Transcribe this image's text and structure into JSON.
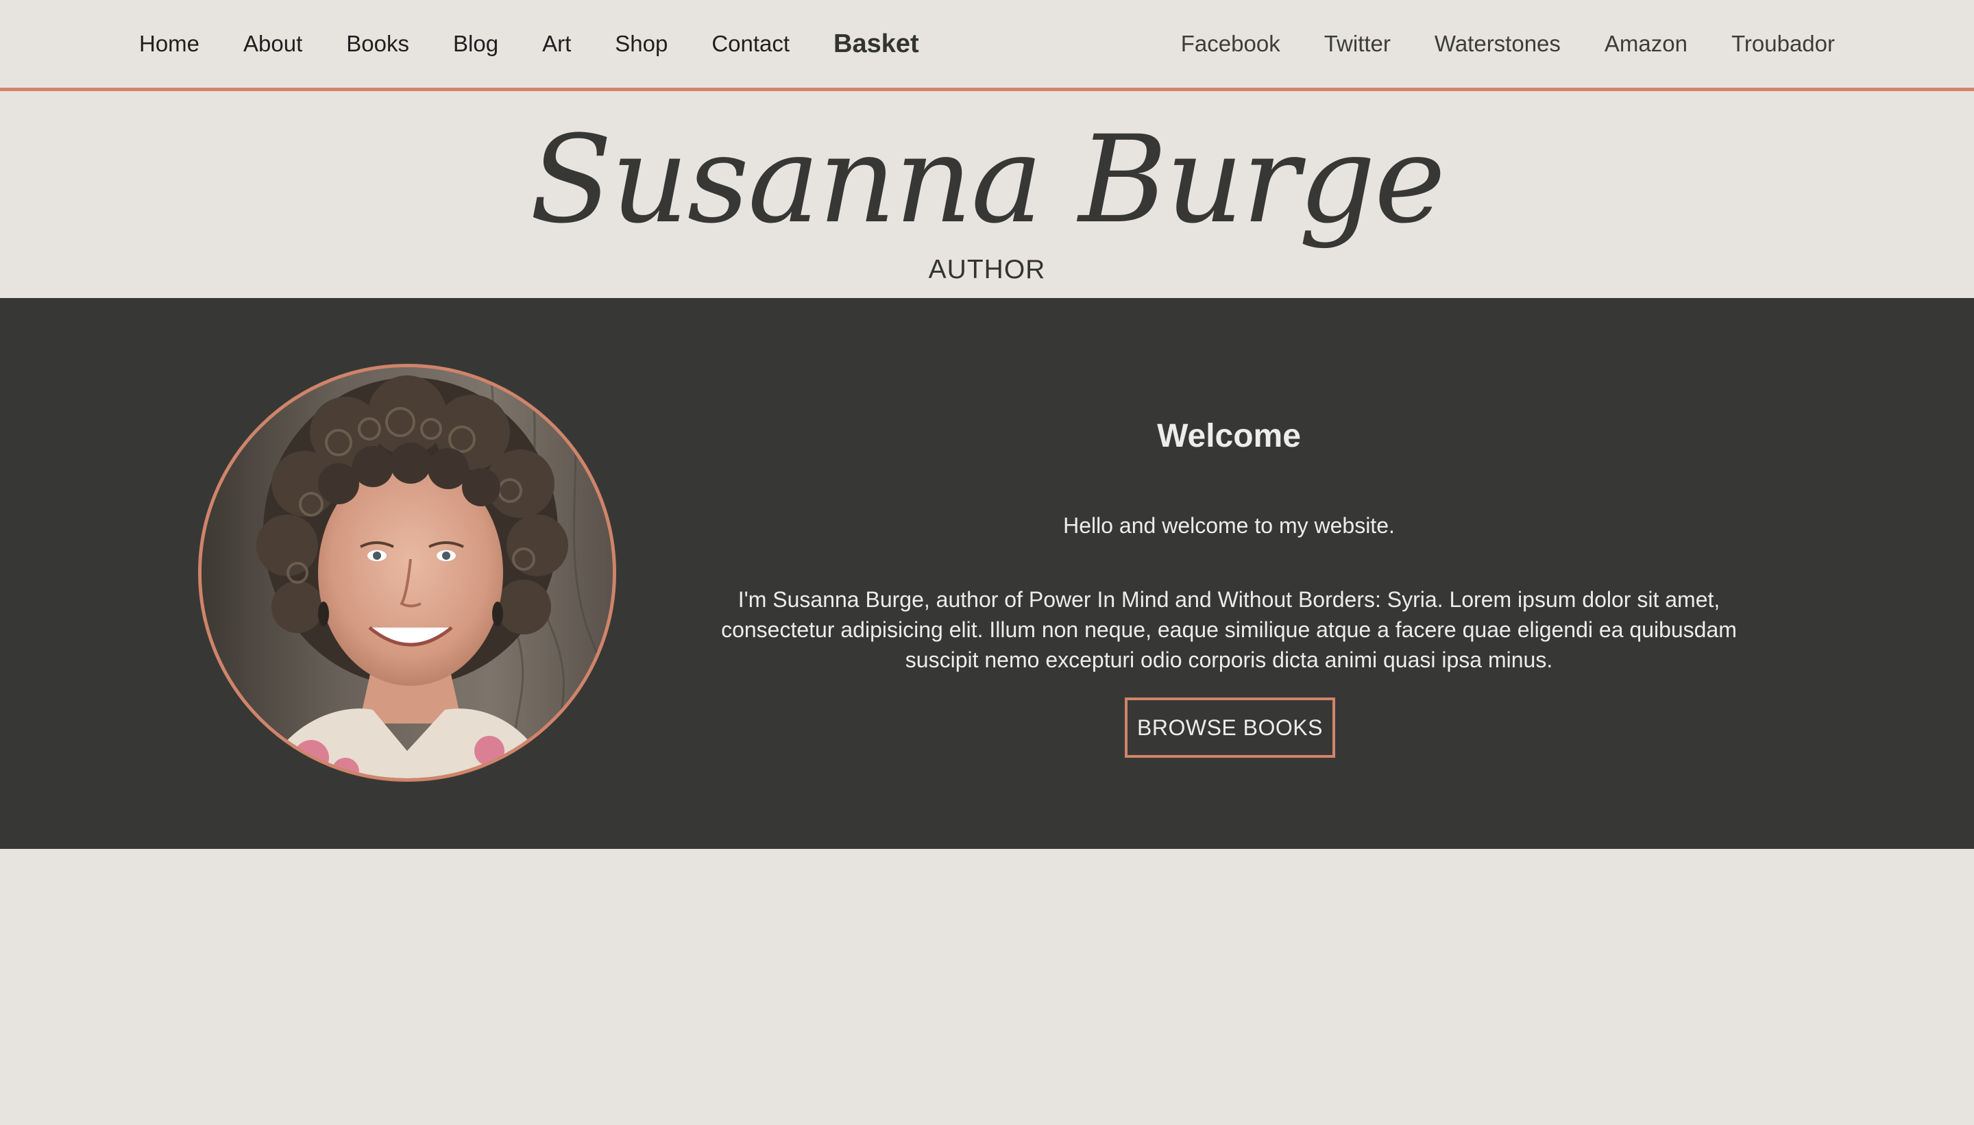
{
  "nav": {
    "left": [
      {
        "id": "home",
        "label": "Home"
      },
      {
        "id": "about",
        "label": "About"
      },
      {
        "id": "books",
        "label": "Books"
      },
      {
        "id": "blog",
        "label": "Blog"
      },
      {
        "id": "art",
        "label": "Art"
      },
      {
        "id": "shop",
        "label": "Shop"
      },
      {
        "id": "contact",
        "label": "Contact"
      }
    ],
    "basket_label": "Basket",
    "right": [
      {
        "id": "facebook",
        "label": "Facebook"
      },
      {
        "id": "twitter",
        "label": "Twitter"
      },
      {
        "id": "waterstones",
        "label": "Waterstones"
      },
      {
        "id": "amazon",
        "label": "Amazon"
      },
      {
        "id": "troubador",
        "label": "Troubador"
      }
    ]
  },
  "brand": {
    "name": "Susanna Burge",
    "role": "AUTHOR"
  },
  "welcome": {
    "title": "Welcome",
    "greeting": "Hello and welcome to my website.",
    "body": "I'm Susanna Burge, author of Power In Mind and Without Borders: Syria. Lorem ipsum dolor sit amet, consectetur adipisicing elit. Illum non neque, eaque similique atque a facere quae eligendi ea quibusdam suscipit nemo excepturi odio corporis dicta animi quasi ipsa minus.",
    "button_label": "BROWSE BOOKS"
  },
  "colors": {
    "page_background": "#e7e4df",
    "band_background": "#373836",
    "accent": "#d0846a",
    "heading_text": "#373735",
    "light_text": "#ededeb"
  }
}
